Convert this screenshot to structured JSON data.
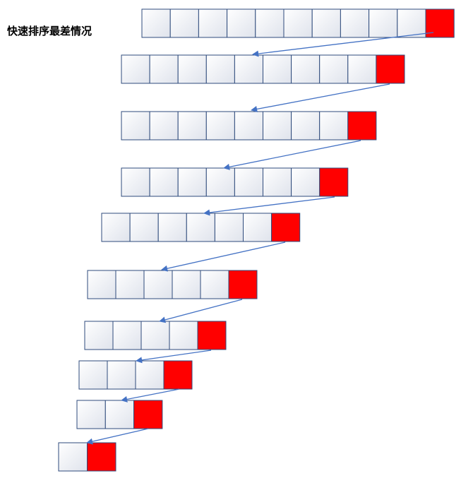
{
  "title": "快速排序最差情况",
  "colors": {
    "cell_border": "#2f4b7c",
    "cell_fill_light": "#ffffff",
    "cell_fill_dark": "#dfe3ec",
    "pivot_fill": "#ff0000",
    "arrow": "#4472c4"
  },
  "rows": [
    {
      "cells": 11,
      "pivot": "last"
    },
    {
      "cells": 10,
      "pivot": "last"
    },
    {
      "cells": 9,
      "pivot": "last"
    },
    {
      "cells": 8,
      "pivot": "last"
    },
    {
      "cells": 7,
      "pivot": "last"
    },
    {
      "cells": 6,
      "pivot": "last"
    },
    {
      "cells": 5,
      "pivot": "last"
    },
    {
      "cells": 4,
      "pivot": "last"
    },
    {
      "cells": 3,
      "pivot": "last"
    },
    {
      "cells": 2,
      "pivot": "last"
    }
  ]
}
